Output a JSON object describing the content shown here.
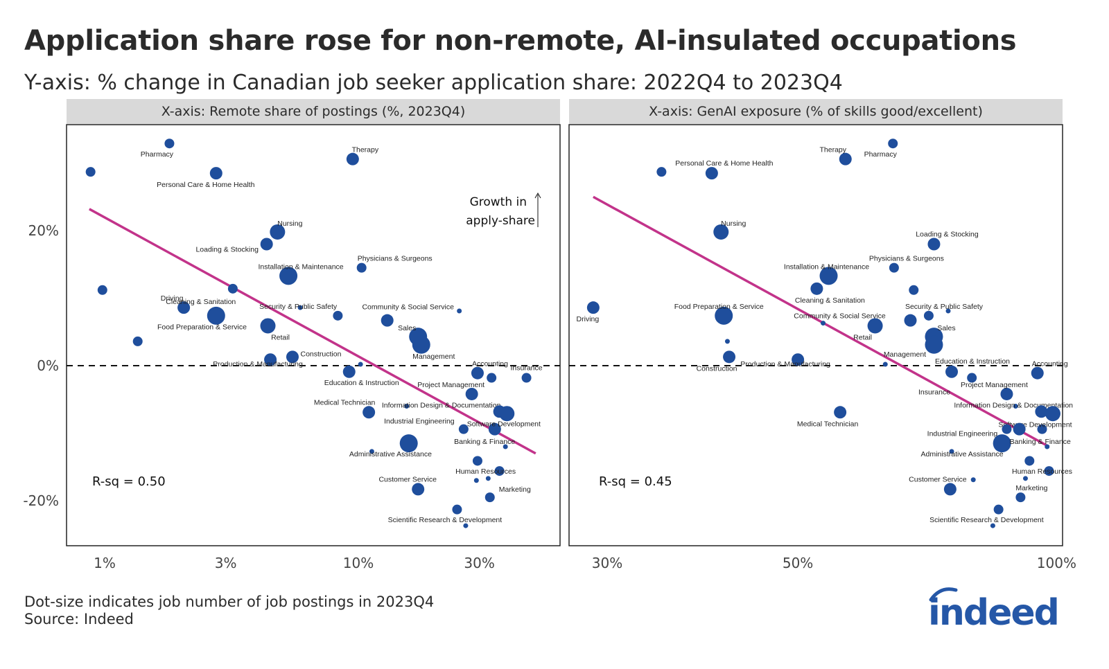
{
  "header": {
    "title": "Application share rose for non-remote, AI-insulated occupations",
    "subtitle": "Y-axis: % change in Canadian job seeker application share: 2022Q4 to 2023Q4"
  },
  "footer": {
    "note": "Dot-size indicates job number of job postings in 2023Q4",
    "source": "Source: Indeed",
    "logo_text": "indeed"
  },
  "colors": {
    "dot": "#1f4e9c",
    "trend": "#c2338a",
    "strip": "#d9d9d9",
    "logo": "#2557a7"
  },
  "chart_data": [
    {
      "type": "scatter",
      "panel_title": "X-axis: Remote share of postings (%, 2023Q4)",
      "x_scale": "log",
      "xlim": [
        0.85,
        60
      ],
      "ylim": [
        -26.5,
        35.5
      ],
      "x_ticks": [
        1,
        3,
        10,
        30
      ],
      "x_tick_labels": [
        "1%",
        "3%",
        "10%",
        "30%"
      ],
      "y_ticks": [
        20,
        0,
        -20
      ],
      "y_tick_labels": [
        "20%",
        "0%",
        "-20%"
      ],
      "zero_line": "dashed",
      "annotation": "Growth in apply-share",
      "annotation_line2": "apply-share",
      "annotation_line1": "Growth in",
      "rsq_label": "R-sq = 0.50",
      "trend": {
        "x": [
          0.87,
          50
        ],
        "y": [
          23.2,
          -13.0
        ]
      },
      "points": [
        {
          "label": "Pharmacy",
          "x": 1.8,
          "y": 32.9,
          "size": 2,
          "lx": -18,
          "ly": 15
        },
        {
          "label": "",
          "x": 0.88,
          "y": 28.7,
          "size": 2
        },
        {
          "label": "Personal Care & Home Health",
          "x": 2.75,
          "y": 28.5,
          "size": 3,
          "lx": -15,
          "ly": 16
        },
        {
          "label": "Therapy",
          "x": 9.5,
          "y": 30.6,
          "size": 3,
          "lx": 18,
          "ly": -14
        },
        {
          "label": "Nursing",
          "x": 4.8,
          "y": 19.8,
          "size": 4,
          "lx": 18,
          "ly": -13
        },
        {
          "label": "Loading & Stocking",
          "x": 4.35,
          "y": 18.0,
          "size": 3,
          "lx": -57,
          "ly": 7
        },
        {
          "label": "Installation & Maintenance",
          "x": 5.3,
          "y": 13.3,
          "size": 5,
          "lx": 18,
          "ly": -14
        },
        {
          "label": "Physicians & Surgeons",
          "x": 10.3,
          "y": 14.5,
          "size": 2,
          "lx": 48,
          "ly": -14
        },
        {
          "label": "",
          "x": 0.98,
          "y": 11.2,
          "size": 2
        },
        {
          "label": "",
          "x": 3.2,
          "y": 11.4,
          "size": 2
        },
        {
          "label": "Driving",
          "x": 2.05,
          "y": 8.6,
          "size": 3,
          "lx": -17,
          "ly": -14
        },
        {
          "label": "Cleaning & Sanitation",
          "x": 2.75,
          "y": 7.4,
          "size": 5,
          "lx": -22,
          "ly": -21,
          "label_offset_note": "label above-right"
        },
        {
          "label": "Security & Public Safety",
          "x": 5.9,
          "y": 8.6,
          "size": 1,
          "lx": -3,
          "ly": -2
        },
        {
          "label": "",
          "x": 8.3,
          "y": 7.4,
          "size": 2
        },
        {
          "label": "Community & Social Service",
          "x": 13.0,
          "y": 6.7,
          "size": 3,
          "lx": 30,
          "ly": -20
        },
        {
          "label": "",
          "x": 25.0,
          "y": 8.1,
          "size": 1
        },
        {
          "label": "Food Preparation & Service",
          "x": 4.4,
          "y": 5.9,
          "size": 4,
          "lx": -95,
          "ly": 1
        },
        {
          "label": "Retail",
          "x": 4.4,
          "y": 5.9,
          "size": 0,
          "lx": 18,
          "ly": 16,
          "label_only": true
        },
        {
          "label": "",
          "x": 1.35,
          "y": 3.6,
          "size": 2
        },
        {
          "label": "Sales",
          "x": 17.2,
          "y": 4.3,
          "size": 5,
          "lx": -16,
          "ly": -13
        },
        {
          "label": "Management",
          "x": 17.7,
          "y": 3.1,
          "size": 5,
          "lx": 18,
          "ly": 16
        },
        {
          "label": "Construction",
          "x": 5.5,
          "y": 1.3,
          "size": 3,
          "lx": 41,
          "ly": -5
        },
        {
          "label": "Production & Manufacturing",
          "x": 4.5,
          "y": 0.9,
          "size": 3,
          "lx": -18,
          "ly": 6
        },
        {
          "label": "",
          "x": 10.2,
          "y": 0.2,
          "size": 1
        },
        {
          "label": "Education & Instruction",
          "x": 9.2,
          "y": -0.9,
          "size": 3,
          "lx": 18,
          "ly": 15
        },
        {
          "label": "Accounting",
          "x": 29.5,
          "y": -1.1,
          "size": 3,
          "lx": 18,
          "ly": -14
        },
        {
          "label": "",
          "x": 33.5,
          "y": -1.8,
          "size": 2
        },
        {
          "label": "Insurance",
          "x": 46.0,
          "y": -1.8,
          "size": 2,
          "lx": 0,
          "ly": -15
        },
        {
          "label": "Project Management",
          "x": 28.0,
          "y": -4.2,
          "size": 3,
          "lx": -30,
          "ly": -14
        },
        {
          "label": "Information Design & Documentation",
          "x": 15.5,
          "y": -6.0,
          "size": 1,
          "lx": 50,
          "ly": -2
        },
        {
          "label": "Medical Technician",
          "x": 11.0,
          "y": -6.9,
          "size": 3,
          "lx": -35,
          "ly": -15
        },
        {
          "label": "",
          "x": 36.0,
          "y": -6.8,
          "size": 3
        },
        {
          "label": "",
          "x": 38.5,
          "y": -7.1,
          "size": 4
        },
        {
          "label": "Software Development",
          "x": 34.5,
          "y": -9.4,
          "size": 3,
          "lx": 13,
          "ly": -8
        },
        {
          "label": "Industrial Engineering",
          "x": 26.0,
          "y": -9.4,
          "size": 2,
          "lx": -64,
          "ly": -12
        },
        {
          "label": "Banking & Finance",
          "x": 38.0,
          "y": -12.0,
          "size": 1,
          "lx": -30,
          "ly": -8
        },
        {
          "label": "",
          "x": 15.8,
          "y": -11.5,
          "size": 5
        },
        {
          "label": "Administrative Assistance",
          "x": 11.3,
          "y": -12.7,
          "size": 1,
          "lx": 27,
          "ly": 3
        },
        {
          "label": "",
          "x": 29.5,
          "y": -14.1,
          "size": 2
        },
        {
          "label": "Human Resources",
          "x": 36.0,
          "y": -15.6,
          "size": 2,
          "lx": -20,
          "ly": 0
        },
        {
          "label": "",
          "x": 29.2,
          "y": -17.0,
          "size": 1
        },
        {
          "label": "",
          "x": 32.5,
          "y": -16.7,
          "size": 1
        },
        {
          "label": "Marketing",
          "x": 33.0,
          "y": -19.5,
          "size": 2,
          "lx": 36,
          "ly": -12
        },
        {
          "label": "Customer Service",
          "x": 17.2,
          "y": -18.3,
          "size": 3,
          "lx": -15,
          "ly": -15
        },
        {
          "label": "",
          "x": 24.5,
          "y": -21.3,
          "size": 2
        },
        {
          "label": "Scientific Research & Development",
          "x": 26.5,
          "y": -23.7,
          "size": 1,
          "lx": -30,
          "ly": -9
        }
      ]
    },
    {
      "type": "scatter",
      "panel_title": "X-axis: GenAI exposure (% of skills good/excellent)",
      "x_scale": "log",
      "xlim": [
        27.0,
        100.5
      ],
      "ylim": [
        -26.5,
        35.5
      ],
      "x_ticks": [
        30,
        50,
        100
      ],
      "x_tick_labels": [
        "30%",
        "50%",
        "100%"
      ],
      "y_ticks": [
        20,
        0,
        -20
      ],
      "zero_line": "dashed",
      "rsq_label": "R-sq = 0.45",
      "trend": {
        "x": [
          28.9,
          98.0
        ],
        "y": [
          25.0,
          -12.0
        ]
      },
      "points": [
        {
          "label": "Pharmacy",
          "x": 64.5,
          "y": 32.9,
          "size": 2,
          "lx": -18,
          "ly": 15
        },
        {
          "label": "Therapy",
          "x": 56.8,
          "y": 30.6,
          "size": 3,
          "lx": -18,
          "ly": -14
        },
        {
          "label": "",
          "x": 34.7,
          "y": 28.7,
          "size": 2
        },
        {
          "label": "Personal Care & Home Health",
          "x": 39.7,
          "y": 28.5,
          "size": 3,
          "lx": 18,
          "ly": -15
        },
        {
          "label": "Nursing",
          "x": 40.7,
          "y": 19.8,
          "size": 4,
          "lx": 18,
          "ly": -13
        },
        {
          "label": "Loading & Stocking",
          "x": 72.0,
          "y": 18.0,
          "size": 3,
          "lx": 19,
          "ly": -15
        },
        {
          "label": "Physicians & Surgeons",
          "x": 64.7,
          "y": 14.5,
          "size": 2,
          "lx": 18,
          "ly": -14
        },
        {
          "label": "Installation & Maintenance",
          "x": 54.3,
          "y": 13.3,
          "size": 5,
          "lx": -3,
          "ly": -14
        },
        {
          "label": "",
          "x": 52.6,
          "y": 11.4,
          "size": 3
        },
        {
          "label": "",
          "x": 68.2,
          "y": 11.2,
          "size": 2
        },
        {
          "label": "Cleaning & Sanitation",
          "x": 52.6,
          "y": 11.4,
          "size": 0,
          "lx": 19,
          "ly": 16,
          "label_only": true
        },
        {
          "label": "Driving",
          "x": 28.9,
          "y": 8.6,
          "size": 3,
          "lx": -8,
          "ly": 16
        },
        {
          "label": "Security & Public Safety",
          "x": 74.8,
          "y": 8.1,
          "size": 1,
          "lx": -6,
          "ly": -7
        },
        {
          "label": "Food Preparation & Service",
          "x": 41.0,
          "y": 7.4,
          "size": 5,
          "lx": -7,
          "ly": -14
        },
        {
          "label": "",
          "x": 71.0,
          "y": 7.4,
          "size": 2
        },
        {
          "label": "Community & Social Service",
          "x": 53.5,
          "y": 6.3,
          "size": 1,
          "lx": 24,
          "ly": -11
        },
        {
          "label": "",
          "x": 67.6,
          "y": 6.7,
          "size": 3
        },
        {
          "label": "Retail",
          "x": 61.5,
          "y": 5.9,
          "size": 4,
          "lx": -18,
          "ly": 16
        },
        {
          "label": "Sales",
          "x": 72.0,
          "y": 4.3,
          "size": 5,
          "lx": 18,
          "ly": -13
        },
        {
          "label": "Management",
          "x": 72.0,
          "y": 3.1,
          "size": 5,
          "lx": -42,
          "ly": 13
        },
        {
          "label": "",
          "x": 41.4,
          "y": 3.6,
          "size": 1
        },
        {
          "label": "Construction",
          "x": 41.6,
          "y": 1.3,
          "size": 3,
          "lx": -18,
          "ly": 16
        },
        {
          "label": "Production & Manufacturing",
          "x": 50.0,
          "y": 0.9,
          "size": 3,
          "lx": -18,
          "ly": 6
        },
        {
          "label": "",
          "x": 63.2,
          "y": 0.2,
          "size": 1
        },
        {
          "label": "Education & Instruction",
          "x": 75.5,
          "y": -0.9,
          "size": 3,
          "lx": 30,
          "ly": -16
        },
        {
          "label": "Insurance",
          "x": 75.5,
          "y": -1.6,
          "size": 0,
          "lx": -25,
          "ly": 22,
          "label_only": true
        },
        {
          "label": "",
          "x": 79.7,
          "y": -1.8,
          "size": 2
        },
        {
          "label": "Accounting",
          "x": 95.0,
          "y": -1.1,
          "size": 3,
          "lx": 18,
          "ly": -14
        },
        {
          "label": "Project Management",
          "x": 87.5,
          "y": -4.2,
          "size": 3,
          "lx": -18,
          "ly": -14
        },
        {
          "label": "Information Design & Documentation",
          "x": 89.6,
          "y": -6.0,
          "size": 1,
          "lx": -3,
          "ly": -2
        },
        {
          "label": "Medical Technician",
          "x": 56.0,
          "y": -6.9,
          "size": 3,
          "lx": -18,
          "ly": 16
        },
        {
          "label": "",
          "x": 96.0,
          "y": -6.8,
          "size": 3
        },
        {
          "label": "",
          "x": 99.0,
          "y": -7.1,
          "size": 4
        },
        {
          "label": "Software Development",
          "x": 96.2,
          "y": -9.4,
          "size": 2,
          "lx": -10,
          "ly": -7
        },
        {
          "label": "Industrial Engineering",
          "x": 87.5,
          "y": -9.4,
          "size": 2,
          "lx": -64,
          "ly": 6
        },
        {
          "label": "",
          "x": 90.5,
          "y": -9.4,
          "size": 3
        },
        {
          "label": "",
          "x": 86.4,
          "y": -11.5,
          "size": 5
        },
        {
          "label": "Banking & Finance",
          "x": 97.5,
          "y": -12.0,
          "size": 1,
          "lx": -10,
          "ly": -8
        },
        {
          "label": "Administrative Assistance",
          "x": 75.5,
          "y": -12.7,
          "size": 1,
          "lx": 15,
          "ly": 3
        },
        {
          "label": "",
          "x": 93.0,
          "y": -14.1,
          "size": 2
        },
        {
          "label": "Human Resources",
          "x": 98.0,
          "y": -15.6,
          "size": 2,
          "lx": -10,
          "ly": 0
        },
        {
          "label": "",
          "x": 80.0,
          "y": -16.9,
          "size": 1
        },
        {
          "label": "",
          "x": 92.0,
          "y": -16.7,
          "size": 1
        },
        {
          "label": "Marketing",
          "x": 90.8,
          "y": -19.5,
          "size": 2,
          "lx": 16,
          "ly": -14
        },
        {
          "label": "Customer Service",
          "x": 75.2,
          "y": -18.3,
          "size": 3,
          "lx": -18,
          "ly": -15
        },
        {
          "label": "",
          "x": 85.6,
          "y": -21.3,
          "size": 2
        },
        {
          "label": "Scientific Research & Development",
          "x": 84.3,
          "y": -23.7,
          "size": 1,
          "lx": -9,
          "ly": -9
        }
      ]
    }
  ]
}
